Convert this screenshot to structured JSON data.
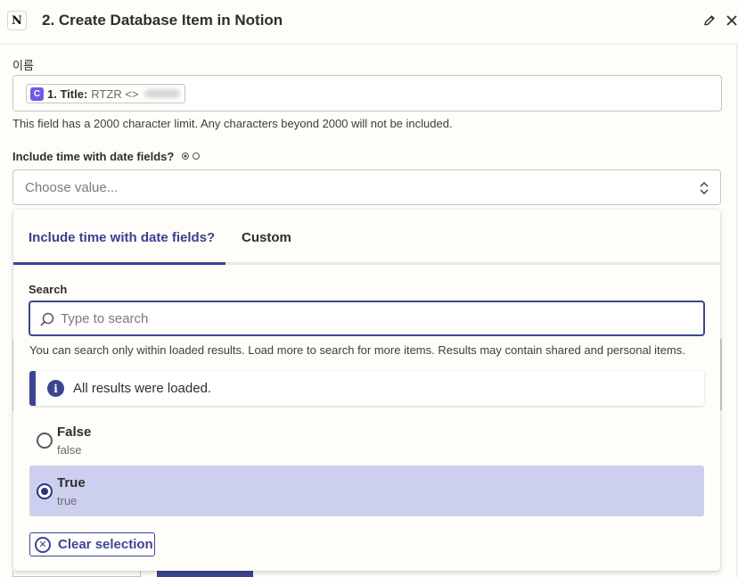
{
  "header": {
    "app_icon_letter": "N",
    "title": "2. Create Database Item in Notion"
  },
  "name_field": {
    "label": "이름",
    "pill": {
      "icon_letter": "C",
      "step": "1. Title:",
      "value": "RTZR <>"
    },
    "helper": "This field has a 2000 character limit. Any characters beyond 2000 will not be included."
  },
  "time_field": {
    "label": "Include time with date fields?",
    "placeholder": "Choose value..."
  },
  "dropdown": {
    "tabs": [
      {
        "label": "Include time with date fields?",
        "active": true
      },
      {
        "label": "Custom",
        "active": false
      }
    ],
    "search_label": "Search",
    "search_placeholder": "Type to search",
    "search_help": "You can search only within loaded results. Load more to search for more items. Results may contain shared and personal items.",
    "info": {
      "icon": "i",
      "text": "All results were loaded."
    },
    "options": [
      {
        "title": "False",
        "value": "false",
        "selected": false
      },
      {
        "title": "True",
        "value": "true",
        "selected": true
      }
    ],
    "clear_label": "Clear selection"
  },
  "colors": {
    "accent": "#3d4592",
    "selected_bg": "#ccd0ee",
    "background": "#fffdf9"
  }
}
